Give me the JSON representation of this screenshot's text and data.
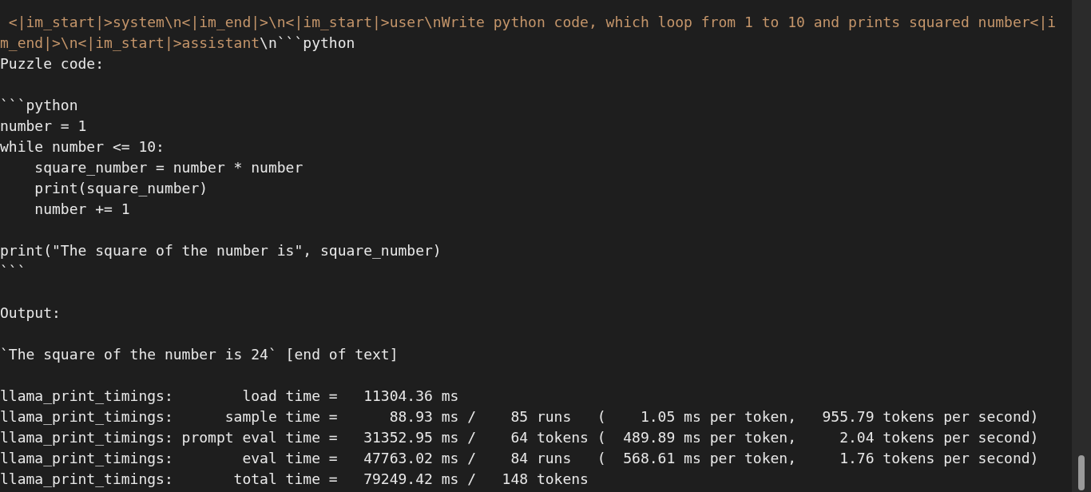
{
  "terminal": {
    "lines": [
      {
        "segments": [
          {
            "text": " <|im_start|>system\\n<|im_end|>\\n<|im_start|>user\\nWrite python code, which loop from 1 to 10 and prints squared number<|i",
            "kind": "prompt"
          }
        ]
      },
      {
        "segments": [
          {
            "text": "m_end|>\\n<|im_start|>assistant",
            "kind": "prompt"
          },
          {
            "text": "\\n```python",
            "kind": "output"
          }
        ]
      },
      {
        "segments": [
          {
            "text": "Puzzle code:",
            "kind": "output"
          }
        ]
      },
      {
        "kind": "blank"
      },
      {
        "segments": [
          {
            "text": "```python",
            "kind": "output"
          }
        ]
      },
      {
        "segments": [
          {
            "text": "number = 1",
            "kind": "output"
          }
        ]
      },
      {
        "segments": [
          {
            "text": "while number <= 10:",
            "kind": "output"
          }
        ]
      },
      {
        "segments": [
          {
            "text": "    square_number = number * number",
            "kind": "output"
          }
        ]
      },
      {
        "segments": [
          {
            "text": "    print(square_number)",
            "kind": "output"
          }
        ]
      },
      {
        "segments": [
          {
            "text": "    number += 1",
            "kind": "output"
          }
        ]
      },
      {
        "kind": "blank"
      },
      {
        "segments": [
          {
            "text": "print(\"The square of the number is\", square_number)",
            "kind": "output"
          }
        ]
      },
      {
        "segments": [
          {
            "text": "```",
            "kind": "output"
          }
        ]
      },
      {
        "kind": "blank"
      },
      {
        "segments": [
          {
            "text": "Output:",
            "kind": "output"
          }
        ]
      },
      {
        "kind": "blank"
      },
      {
        "segments": [
          {
            "text": "`The square of the number is 24` [end of text]",
            "kind": "output"
          }
        ]
      },
      {
        "kind": "blank"
      },
      {
        "segments": [
          {
            "text": "llama_print_timings:        load time =   11304.36 ms",
            "kind": "output"
          }
        ]
      },
      {
        "segments": [
          {
            "text": "llama_print_timings:      sample time =      88.93 ms /    85 runs   (    1.05 ms per token,   955.79 tokens per second)",
            "kind": "output"
          }
        ]
      },
      {
        "segments": [
          {
            "text": "llama_print_timings: prompt eval time =   31352.95 ms /    64 tokens (  489.89 ms per token,     2.04 tokens per second)",
            "kind": "output"
          }
        ]
      },
      {
        "segments": [
          {
            "text": "llama_print_timings:        eval time =   47763.02 ms /    84 runs   (  568.61 ms per token,     1.76 tokens per second)",
            "kind": "output"
          }
        ]
      },
      {
        "segments": [
          {
            "text": "llama_print_timings:       total time =   79249.42 ms /   148 tokens",
            "kind": "output"
          }
        ]
      }
    ]
  }
}
